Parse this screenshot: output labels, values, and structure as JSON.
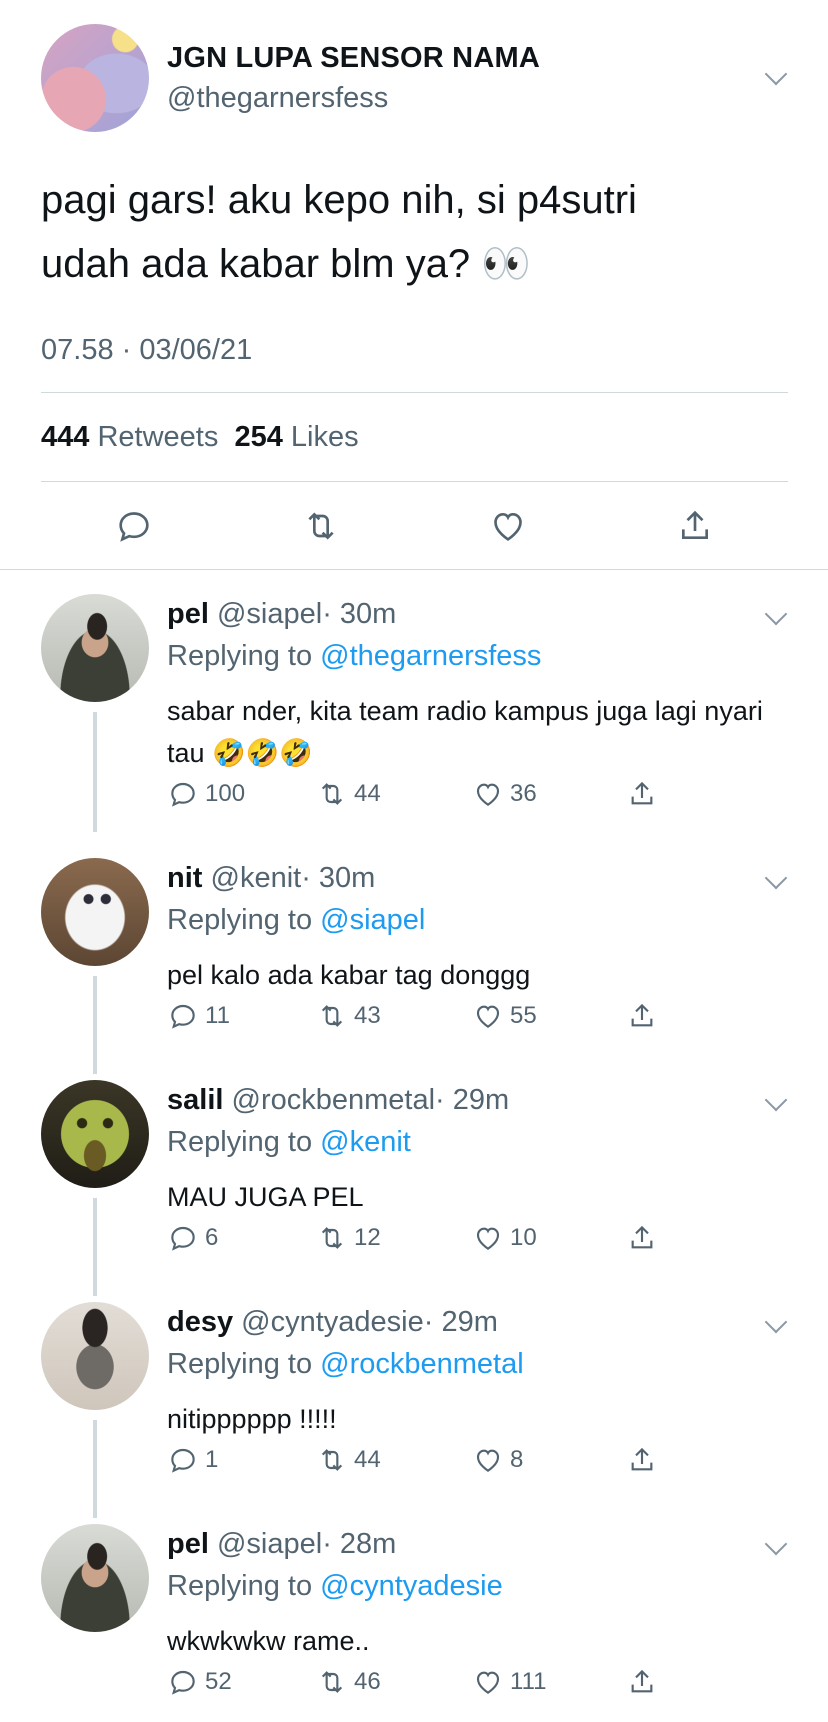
{
  "main_tweet": {
    "display_name": "JGN LUPA SENSOR NAMA",
    "handle": "@thegarnersfess",
    "text_line1": "pagi gars! aku kepo nih, si p4sutri",
    "text_line2": "udah ada kabar blm ya? 👀",
    "timestamp": "07.58 · 03/06/21",
    "retweets_count": "444",
    "retweets_label": "Retweets",
    "likes_count": "254",
    "likes_label": "Likes"
  },
  "replying_label": "Replying to",
  "replies": [
    {
      "name": "pel",
      "handle": "@siapel",
      "time": "· 30m",
      "reply_to": "@thegarnersfess",
      "text": "sabar nder, kita team radio kampus juga lagi nyari tau 🤣🤣🤣",
      "replies": "100",
      "retweets": "44",
      "likes": "36"
    },
    {
      "name": "nit",
      "handle": "@kenit",
      "time": "· 30m",
      "reply_to": "@siapel",
      "text": "pel kalo ada kabar tag donggg",
      "replies": "11",
      "retweets": "43",
      "likes": "55"
    },
    {
      "name": "salil",
      "handle": "@rockbenmetal",
      "time": "· 29m",
      "reply_to": "@kenit",
      "text": "MAU JUGA PEL",
      "replies": "6",
      "retweets": "12",
      "likes": "10"
    },
    {
      "name": "desy",
      "handle": "@cyntyadesie",
      "time": "· 29m",
      "reply_to": "@rockbenmetal",
      "text": "nitipppppp !!!!!",
      "replies": "1",
      "retweets": "44",
      "likes": "8"
    },
    {
      "name": "pel",
      "handle": "@siapel",
      "time": "· 28m",
      "reply_to": "@cyntyadesie",
      "text": "wkwkwkw rame..",
      "replies": "52",
      "retweets": "46",
      "likes": "111"
    }
  ],
  "colors": {
    "link": "#1d9bf0",
    "secondary_text": "#536471",
    "divider": "#cfd9de"
  }
}
